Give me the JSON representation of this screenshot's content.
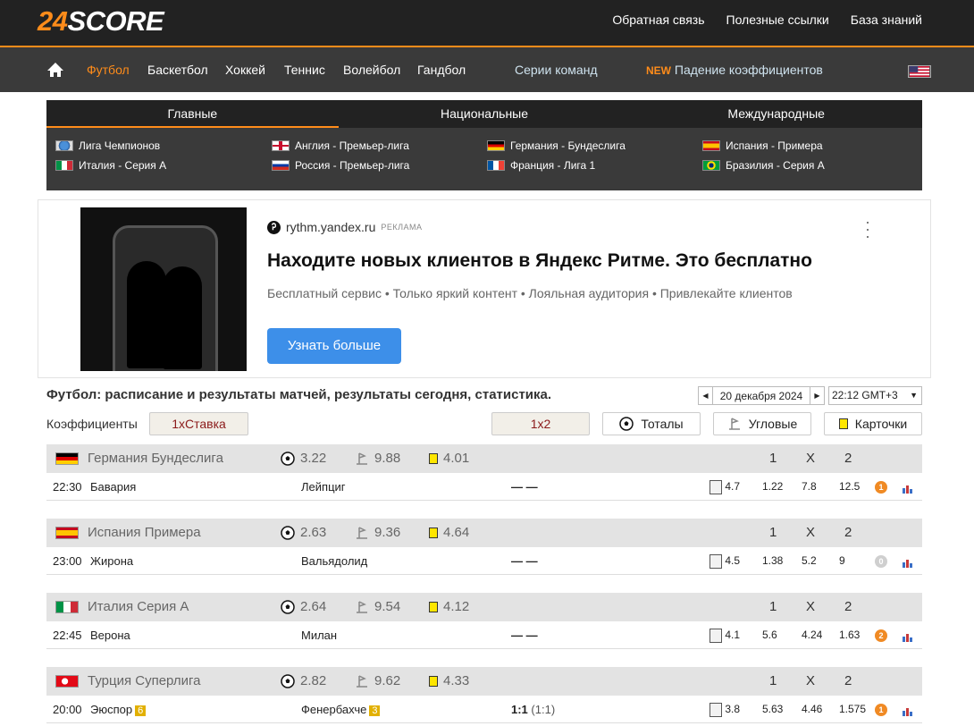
{
  "logo": {
    "num": "24",
    "txt": "SCORE"
  },
  "toplinks": [
    "Обратная связь",
    "Полезные ссылки",
    "База знаний"
  ],
  "nav": {
    "sports": [
      "Футбол",
      "Баскетбол",
      "Хоккей",
      "Теннис",
      "Волейбол",
      "Гандбол"
    ],
    "series": "Серии команд",
    "new_tag": "NEW",
    "new_label": "Падение коэффициентов"
  },
  "league_tabs": [
    "Главные",
    "Национальные",
    "Международные"
  ],
  "leagues": [
    {
      "name": "Лига Чемпионов",
      "flag": "world"
    },
    {
      "name": "Англия - Премьер-лига",
      "flag": "england"
    },
    {
      "name": "Германия - Бундеслига",
      "flag": "germany"
    },
    {
      "name": "Испания - Примера",
      "flag": "spain"
    },
    {
      "name": "Италия - Серия А",
      "flag": "italy"
    },
    {
      "name": "Россия - Премьер-лига",
      "flag": "russia"
    },
    {
      "name": "Франция - Лига 1",
      "flag": "france"
    },
    {
      "name": "Бразилия - Серия А",
      "flag": "brazil"
    }
  ],
  "ad": {
    "domain": "rythm.yandex.ru",
    "tag": "РЕКЛАМА",
    "title": "Находите новых клиентов в Яндекс Ритме. Это бесплатно",
    "subtitle": "Бесплатный сервис • Только яркий контент • Лояльная аудитория • Привлекайте клиентов",
    "button": "Узнать больше",
    "logo_letter": "Ꭾ"
  },
  "heading": "Футбол: расписание и результаты матчей, результаты сегодня, статистика.",
  "date": "20 декабря 2024",
  "timezone": "22:12 GMT+3",
  "coef_label": "Коэффициенты",
  "filters": {
    "bookmaker": "1хСтавка",
    "market": "1х2",
    "totals": "Тоталы",
    "corners": "Угловые",
    "cards": "Карточки"
  },
  "odds_headers": [
    "1",
    "X",
    "2"
  ],
  "leagues_matches": [
    {
      "league": "Германия Бундеслига",
      "flag": "germany",
      "goals": "3.22",
      "corners": "9.88",
      "cards": "4.01",
      "match": {
        "time": "22:30",
        "home": "Бавария",
        "away": "Лейпциг",
        "score": "— —",
        "ref": "4.7",
        "o1": "1.22",
        "ox": "7.8",
        "o2": "12.5",
        "badge": "1",
        "badge_color": "#f08a24",
        "home_rc": "",
        "away_rc": ""
      }
    },
    {
      "league": "Испания Примера",
      "flag": "spain",
      "goals": "2.63",
      "corners": "9.36",
      "cards": "4.64",
      "match": {
        "time": "23:00",
        "home": "Жирона",
        "away": "Вальядолид",
        "score": "— —",
        "ref": "4.5",
        "o1": "1.38",
        "ox": "5.2",
        "o2": "9",
        "badge": "0",
        "badge_color": "#cfcfcf",
        "home_rc": "",
        "away_rc": ""
      }
    },
    {
      "league": "Италия Серия А",
      "flag": "italy",
      "goals": "2.64",
      "corners": "9.54",
      "cards": "4.12",
      "match": {
        "time": "22:45",
        "home": "Верона",
        "away": "Милан",
        "score": "— —",
        "ref": "4.1",
        "o1": "5.6",
        "ox": "4.24",
        "o2": "1.63",
        "badge": "2",
        "badge_color": "#f08a24",
        "home_rc": "",
        "away_rc": ""
      }
    },
    {
      "league": "Турция Суперлига",
      "flag": "turkey",
      "goals": "2.82",
      "corners": "9.62",
      "cards": "4.33",
      "match": {
        "time": "20:00",
        "home": "Эюспор",
        "away": "Фенербахче",
        "score": "1:1",
        "score_ht": "(1:1)",
        "ref": "3.8",
        "o1": "5.63",
        "ox": "4.46",
        "o2": "1.575",
        "badge": "1",
        "badge_color": "#f08a24",
        "home_rc": "6",
        "away_rc": "3"
      }
    }
  ]
}
